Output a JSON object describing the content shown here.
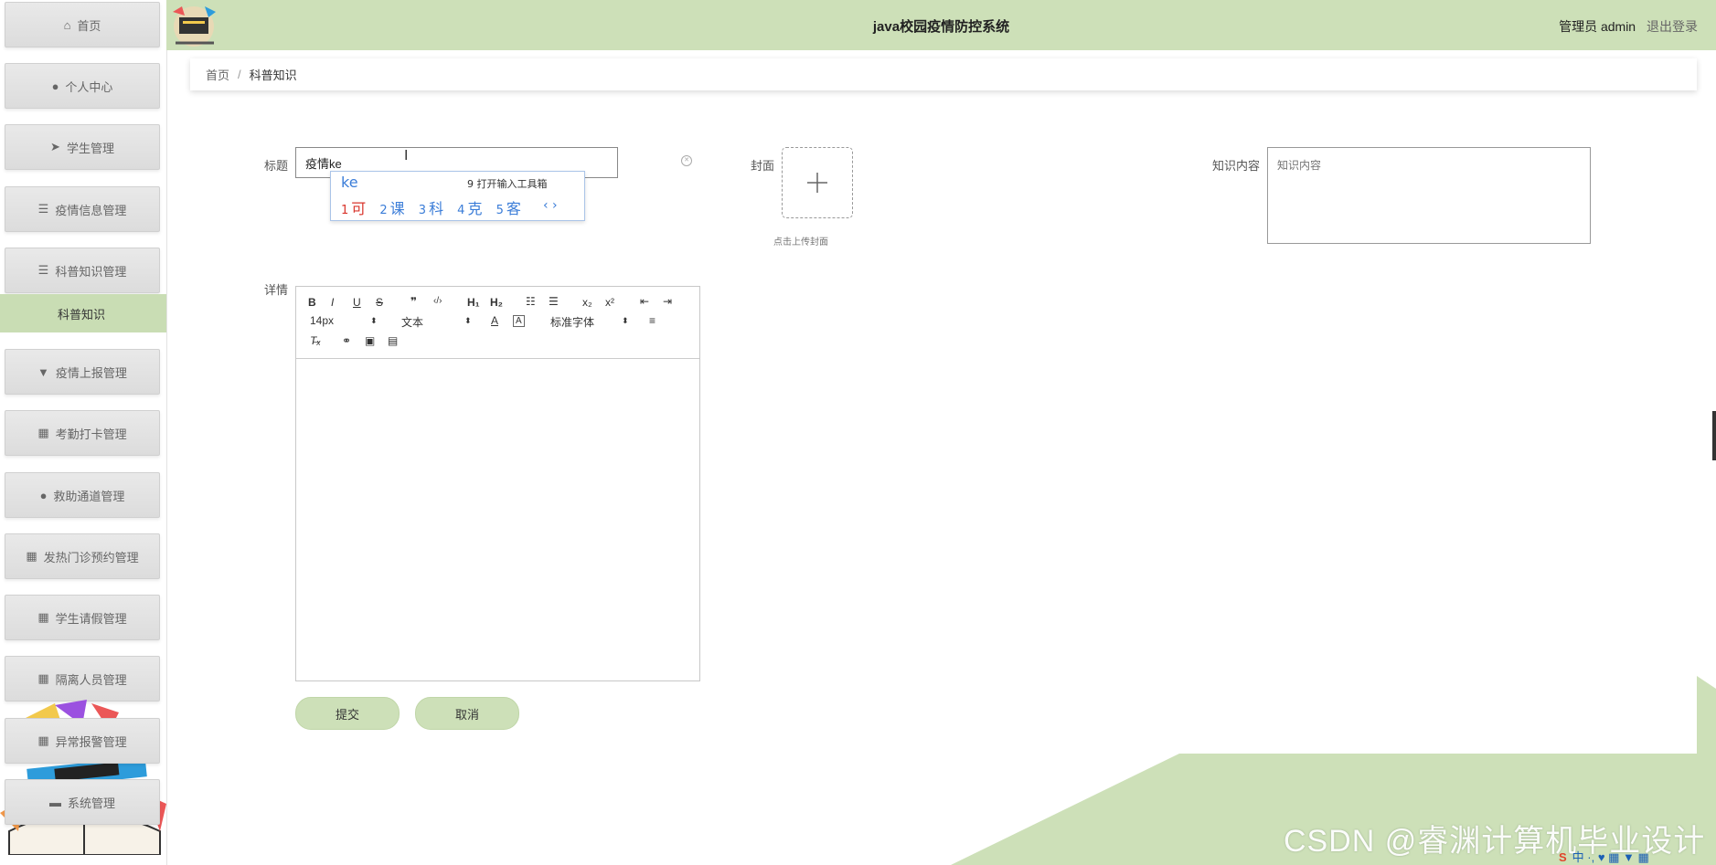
{
  "header": {
    "title": "java校园疫情防控系统",
    "user_label": "管理员 admin",
    "logout_label": "退出登录"
  },
  "sidebar": {
    "items": [
      {
        "label": "首页",
        "icon": "home-icon",
        "glyph": "⌂"
      },
      {
        "label": "个人中心",
        "icon": "user-icon",
        "glyph": "●"
      },
      {
        "label": "学生管理",
        "icon": "send-icon",
        "glyph": "➤"
      },
      {
        "label": "疫情信息管理",
        "icon": "list-icon",
        "glyph": "☰"
      },
      {
        "label": "科普知识管理",
        "icon": "list-icon",
        "glyph": "☰"
      },
      {
        "label": "疫情上报管理",
        "icon": "trophy-icon",
        "glyph": "▼"
      },
      {
        "label": "考勤打卡管理",
        "icon": "grid-icon",
        "glyph": "▦"
      },
      {
        "label": "救助通道管理",
        "icon": "location-icon",
        "glyph": "●"
      },
      {
        "label": "发热门诊预约管理",
        "icon": "grid-icon",
        "glyph": "▦"
      },
      {
        "label": "学生请假管理",
        "icon": "grid-icon",
        "glyph": "▦"
      },
      {
        "label": "隔离人员管理",
        "icon": "grid-icon",
        "glyph": "▦"
      },
      {
        "label": "异常报警管理",
        "icon": "grid-icon",
        "glyph": "▦"
      },
      {
        "label": "系统管理",
        "icon": "monitor-icon",
        "glyph": "▬"
      }
    ],
    "submenu_active": "科普知识"
  },
  "breadcrumb": {
    "home": "首页",
    "separator": "/",
    "current": "科普知识"
  },
  "form": {
    "title_label": "标题",
    "title_value": "疫情ke",
    "cover_label": "封面",
    "cover_hint": "点击上传封面",
    "content_label": "知识内容",
    "content_placeholder": "知识内容",
    "detail_label": "详情",
    "submit_label": "提交",
    "cancel_label": "取消"
  },
  "ime": {
    "pinyin": "ke",
    "tool_hint": "9 打开输入工具箱",
    "candidates": [
      {
        "num": "1",
        "char": "可"
      },
      {
        "num": "2",
        "char": "课"
      },
      {
        "num": "3",
        "char": "科"
      },
      {
        "num": "4",
        "char": "克"
      },
      {
        "num": "5",
        "char": "客"
      }
    ]
  },
  "editor": {
    "font_size": "14px",
    "paragraph": "文本",
    "font_family": "标准字体"
  },
  "watermark": "CSDN @睿渊计算机毕业设计",
  "tray": "中 ·, ♥ ▦ ▼ ▦",
  "colors": {
    "accent_green": "#cde0b8",
    "submenu_green": "#c9ddb4",
    "ime_blue": "#3b7dd8",
    "ime_first_red": "#d9352c"
  }
}
